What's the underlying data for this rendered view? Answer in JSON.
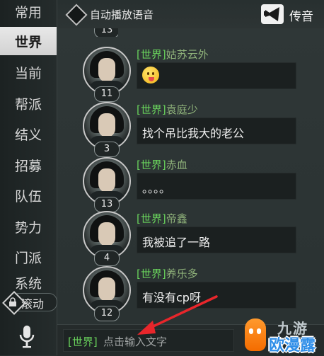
{
  "sidebar": {
    "tabs": [
      {
        "label": "常用"
      },
      {
        "label": "世界"
      },
      {
        "label": "当前"
      },
      {
        "label": "帮派"
      },
      {
        "label": "结义"
      },
      {
        "label": "招募"
      },
      {
        "label": "队伍"
      },
      {
        "label": "势力"
      },
      {
        "label": "门派"
      },
      {
        "label": "系统"
      }
    ],
    "active_tab": "世界",
    "scroll_button_label": "滚动"
  },
  "header": {
    "autoplay_label": "自动播放语音",
    "horn_label": "传音"
  },
  "chat": {
    "top_partial_level": "13",
    "messages": [
      {
        "channel": "[世界]",
        "name": "姑苏云外",
        "level": "11",
        "text": "",
        "emoji": "tongue-out-emoji"
      },
      {
        "channel": "[世界]",
        "name": "袁庭少",
        "level": "3",
        "text": "找个吊比我大的老公"
      },
      {
        "channel": "[世界]",
        "name": "赤血",
        "level": "13",
        "text": "。。。。"
      },
      {
        "channel": "[世界]",
        "name": "帝鑫",
        "level": "4",
        "text": "我被追了一路"
      },
      {
        "channel": "[世界]",
        "name": "养乐多",
        "level": "12",
        "text": "有没有cp呀"
      }
    ]
  },
  "input": {
    "channel": "[世界]",
    "placeholder": "点击输入文字"
  },
  "watermark": {
    "line1": "九游",
    "line2": "欧漫露"
  },
  "colors": {
    "channel_green": "#69d25c",
    "name_green": "#8fb27a",
    "arrow_red": "#e8262b"
  }
}
